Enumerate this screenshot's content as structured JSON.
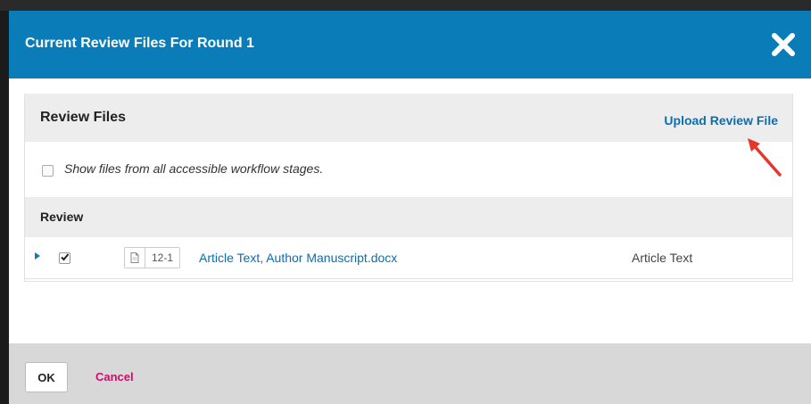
{
  "modal": {
    "title": "Current Review Files For Round 1",
    "close_icon": "close-x-icon"
  },
  "panel": {
    "title": "Review Files",
    "upload_label": "Upload Review File",
    "filter_label": "Show files from all accessible workflow stages.",
    "filter_checked": false
  },
  "section": {
    "title": "Review"
  },
  "files": [
    {
      "id": "12-1",
      "name": "Article Text, Author Manuscript.docx",
      "type": "Article Text",
      "checked": true,
      "icon": "document-icon"
    }
  ],
  "footer": {
    "ok_label": "OK",
    "cancel_label": "Cancel"
  },
  "colors": {
    "header": "#0a7db8",
    "link": "#0a6eb0",
    "cancel": "#d00a6c",
    "annotation_arrow": "#e8352b"
  }
}
